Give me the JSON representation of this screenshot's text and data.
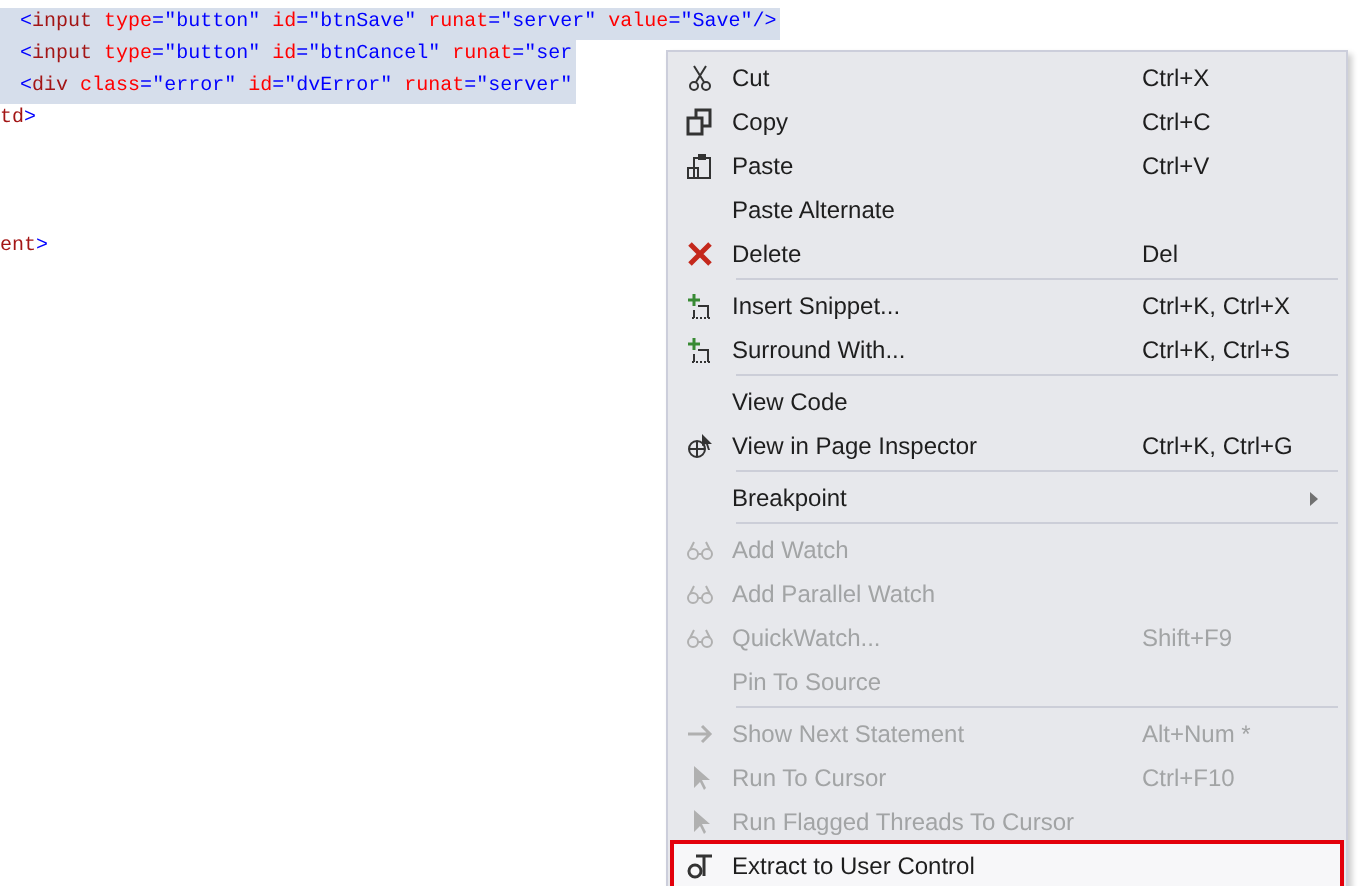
{
  "editor": {
    "lines": [
      {
        "selected": true,
        "tokens": [
          {
            "kind": "punct",
            "text": "<"
          },
          {
            "kind": "tag",
            "text": "input"
          },
          {
            "kind": "attr",
            "text": " type"
          },
          {
            "kind": "punct",
            "text": "="
          },
          {
            "kind": "value",
            "text": "\"button\""
          },
          {
            "kind": "attr",
            "text": " id"
          },
          {
            "kind": "punct",
            "text": "="
          },
          {
            "kind": "value",
            "text": "\"btnSave\""
          },
          {
            "kind": "attr",
            "text": " runat"
          },
          {
            "kind": "punct",
            "text": "="
          },
          {
            "kind": "value",
            "text": "\"server\""
          },
          {
            "kind": "attr",
            "text": " value"
          },
          {
            "kind": "punct",
            "text": "="
          },
          {
            "kind": "value",
            "text": "\"Save\""
          },
          {
            "kind": "punct",
            "text": "/>"
          }
        ]
      },
      {
        "selected": true,
        "tokens": [
          {
            "kind": "punct",
            "text": "<"
          },
          {
            "kind": "tag",
            "text": "input"
          },
          {
            "kind": "attr",
            "text": " type"
          },
          {
            "kind": "punct",
            "text": "="
          },
          {
            "kind": "value",
            "text": "\"button\""
          },
          {
            "kind": "attr",
            "text": " id"
          },
          {
            "kind": "punct",
            "text": "="
          },
          {
            "kind": "value",
            "text": "\"btnCancel\""
          },
          {
            "kind": "attr",
            "text": " runat"
          },
          {
            "kind": "punct",
            "text": "="
          },
          {
            "kind": "value",
            "text": "\"ser"
          }
        ]
      },
      {
        "selected": true,
        "tokens": [
          {
            "kind": "punct",
            "text": "<"
          },
          {
            "kind": "tag",
            "text": "div"
          },
          {
            "kind": "attr",
            "text": " class"
          },
          {
            "kind": "punct",
            "text": "="
          },
          {
            "kind": "value",
            "text": "\"error\""
          },
          {
            "kind": "attr",
            "text": " id"
          },
          {
            "kind": "punct",
            "text": "="
          },
          {
            "kind": "value",
            "text": "\"dvError\""
          },
          {
            "kind": "attr",
            "text": " runat"
          },
          {
            "kind": "punct",
            "text": "="
          },
          {
            "kind": "value",
            "text": "\"server\""
          }
        ]
      },
      {
        "selected": false,
        "tokens": [
          {
            "kind": "tag",
            "text": "td"
          },
          {
            "kind": "punct",
            "text": ">"
          }
        ]
      },
      {
        "selected": false,
        "tokens": [
          {
            "kind": "tag",
            "text": "ent"
          },
          {
            "kind": "punct",
            "text": ">"
          }
        ]
      }
    ]
  },
  "context_menu": {
    "items": [
      {
        "kind": "item",
        "label": "Cut",
        "shortcut": "Ctrl+X",
        "disabled": false,
        "selected": false
      },
      {
        "kind": "item",
        "label": "Copy",
        "shortcut": "Ctrl+C",
        "disabled": false,
        "selected": false
      },
      {
        "kind": "item",
        "label": "Paste",
        "shortcut": "Ctrl+V",
        "disabled": false,
        "selected": false
      },
      {
        "kind": "item",
        "label": "Paste Alternate",
        "disabled": false,
        "selected": false
      },
      {
        "kind": "item",
        "label": "Delete",
        "shortcut": "Del",
        "disabled": false,
        "selected": false
      },
      {
        "kind": "separator"
      },
      {
        "kind": "item",
        "label": "Insert Snippet...",
        "shortcut": "Ctrl+K, Ctrl+X",
        "disabled": false,
        "selected": false
      },
      {
        "kind": "item",
        "label": "Surround With...",
        "shortcut": "Ctrl+K, Ctrl+S",
        "disabled": false,
        "selected": false
      },
      {
        "kind": "separator"
      },
      {
        "kind": "item",
        "label": "View Code",
        "disabled": false,
        "selected": false
      },
      {
        "kind": "item",
        "label": "View in Page Inspector",
        "shortcut": "Ctrl+K, Ctrl+G",
        "disabled": false,
        "selected": false
      },
      {
        "kind": "separator"
      },
      {
        "kind": "submenu",
        "label": "Breakpoint",
        "disabled": false,
        "selected": false
      },
      {
        "kind": "separator"
      },
      {
        "kind": "item",
        "label": "Add Watch",
        "disabled": true,
        "selected": false
      },
      {
        "kind": "item",
        "label": "Add Parallel Watch",
        "disabled": true,
        "selected": false
      },
      {
        "kind": "item",
        "label": "QuickWatch...",
        "shortcut": "Shift+F9",
        "disabled": true,
        "selected": false
      },
      {
        "kind": "item",
        "label": "Pin To Source",
        "disabled": true,
        "selected": false
      },
      {
        "kind": "separator"
      },
      {
        "kind": "item",
        "label": "Show Next Statement",
        "shortcut": "Alt+Num *",
        "disabled": true,
        "selected": false
      },
      {
        "kind": "item",
        "label": "Run To Cursor",
        "shortcut": "Ctrl+F10",
        "disabled": true,
        "selected": false
      },
      {
        "kind": "item",
        "label": "Run Flagged Threads To Cursor",
        "disabled": true,
        "selected": false
      },
      {
        "kind": "item",
        "label": "Extract to User Control",
        "disabled": false,
        "selected": true
      }
    ]
  }
}
